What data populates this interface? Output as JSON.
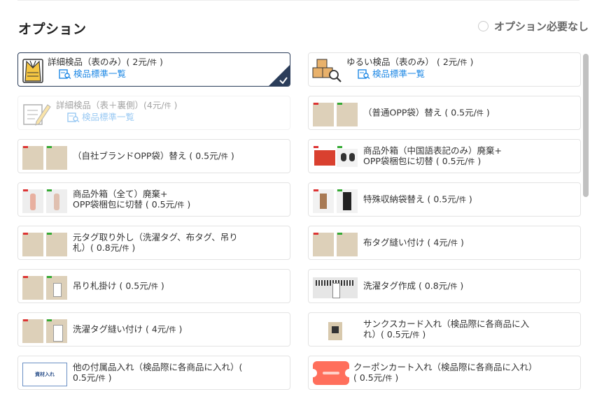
{
  "header": {
    "title": "オプション",
    "no_option_label": "オプション必要なし"
  },
  "options_left": [
    {
      "name": "詳細検品（表のみ）",
      "price": "( 2元/",
      "unit": "件",
      "close": " )",
      "link": "検品標準一覧",
      "selected": true,
      "icon": "jacket-checklist-icon"
    },
    {
      "name": "詳細検品（表＋裏側）",
      "price": "(4元/",
      "unit": "件",
      "close": " )",
      "link": "検品標準一覧",
      "disabled": true,
      "icon": "notepad-pen-icon"
    },
    {
      "name": "（自社ブランドOPP袋）替え",
      "price": " ( 0.5元/",
      "unit": "件",
      "close": " )",
      "icon": "opp-bag-photo"
    },
    {
      "line1": "商品外箱（全て）廃棄+",
      "line2": "OPP袋梱包に切替 ( 0.5元/",
      "unit": "件",
      "close": " )",
      "icon": "box-disposal-photo"
    },
    {
      "line1": "元タグ取り外し（洗濯タグ、布タグ、吊り",
      "line2": "札）( 0.8元/",
      "unit": "件",
      "close": " )",
      "icon": "remove-tag-photo"
    },
    {
      "name": "吊り札掛け",
      "price": " ( 0.5元/",
      "unit": "件",
      "close": " )",
      "icon": "hang-tag-photo"
    },
    {
      "name": "洗濯タグ縫い付け",
      "price": " ( 4元/",
      "unit": "件",
      "close": " )",
      "icon": "sew-wash-tag-photo"
    },
    {
      "line1": "他の付属品入れ（検品際に各商品に入れ）(",
      "line2": "0.5元/",
      "unit": "件",
      "close": " )",
      "icon": "materials-label",
      "badge": "資材入れ"
    }
  ],
  "options_right": [
    {
      "name": "ゆるい検品（表のみ）",
      "price": " ( 2元/",
      "unit": "件",
      "close": " )",
      "link": "検品標準一覧",
      "icon": "boxes-magnifier-icon"
    },
    {
      "name": "（普通OPP袋）替え",
      "price": " ( 0.5元/",
      "unit": "件",
      "close": " )",
      "icon": "normal-opp-photo"
    },
    {
      "line1": "商品外箱（中国語表記のみ）廃棄+",
      "line2": "OPP袋梱包に切替 ( 0.5元/",
      "unit": "件",
      "close": " )",
      "icon": "chinese-box-photo"
    },
    {
      "name": "特殊収納袋替え",
      "price": " ( 0.5元/",
      "unit": "件",
      "close": " )",
      "icon": "special-bag-photo"
    },
    {
      "name": "布タグ縫い付け",
      "price": " ( 4元/",
      "unit": "件",
      "close": " )",
      "icon": "fabric-tag-photo"
    },
    {
      "name": "洗濯タグ作成",
      "price": " ( 0.8元/",
      "unit": "件",
      "close": " )",
      "icon": "make-wash-tag-photo"
    },
    {
      "line1": "サンクスカード入れ（検品際に各商品に入",
      "line2": "れ）( 0.5元/",
      "unit": "件",
      "close": " )",
      "icon": "thanks-card-photo"
    },
    {
      "line1": "クーポンカート入れ（検品際に各商品に入れ）",
      "line2": "( 0.5元/",
      "unit": "件",
      "close": " )",
      "icon": "coupon-card-icon"
    }
  ],
  "colors": {
    "accent": "#1e88e5",
    "selected_border": "#2b3d5a"
  }
}
